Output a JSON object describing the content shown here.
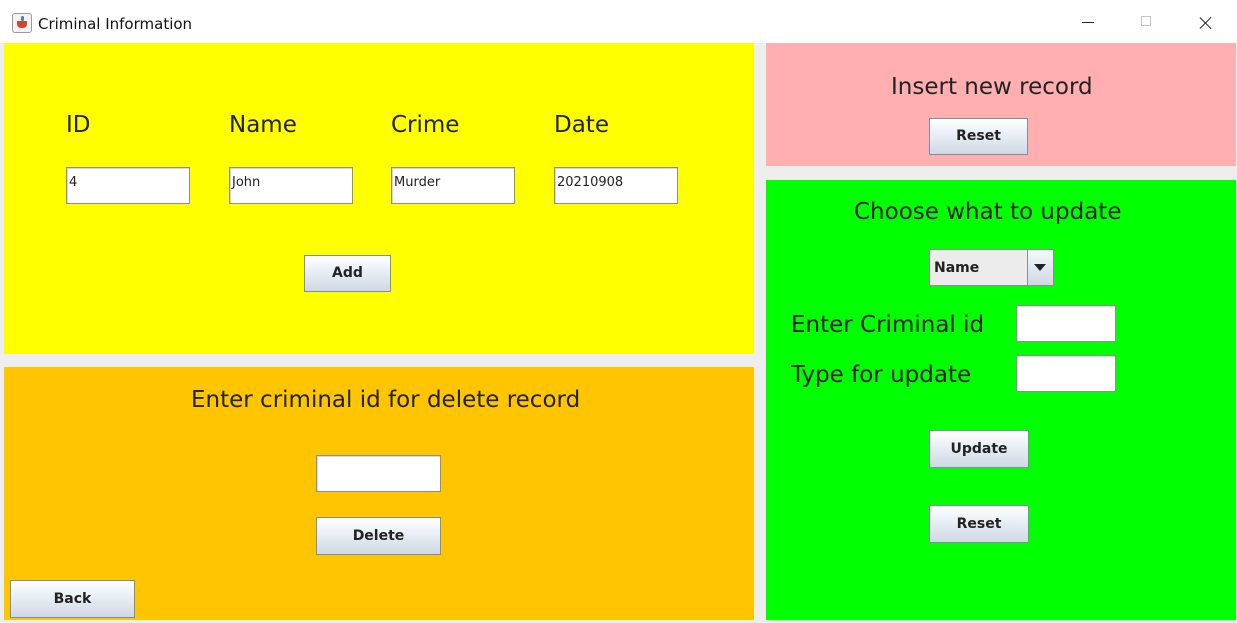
{
  "window": {
    "title": "Criminal Information",
    "app_icon": "java-cup-icon"
  },
  "add_panel": {
    "labels": {
      "id": "ID",
      "name": "Name",
      "crime": "Crime",
      "date": "Date"
    },
    "values": {
      "id": "4",
      "name": "John",
      "crime": "Murder",
      "date": "20210908"
    },
    "add_label": "Add"
  },
  "delete_panel": {
    "heading": "Enter criminal id for delete record",
    "id_value": "",
    "delete_label": "Delete",
    "back_label": "Back"
  },
  "insert_panel": {
    "heading": "Insert new record",
    "reset_label": "Reset"
  },
  "update_panel": {
    "heading": "Choose what to update",
    "field_select": {
      "selected": "Name"
    },
    "criminal_id_label": "Enter Criminal id",
    "criminal_id_value": "",
    "type_label": "Type for update",
    "type_value": "",
    "update_label": "Update",
    "reset_label": "Reset"
  },
  "colors": {
    "add_panel": "#ffff00",
    "delete_panel": "#ffc600",
    "insert_panel": "#ffafaf",
    "update_panel": "#00ff00"
  }
}
